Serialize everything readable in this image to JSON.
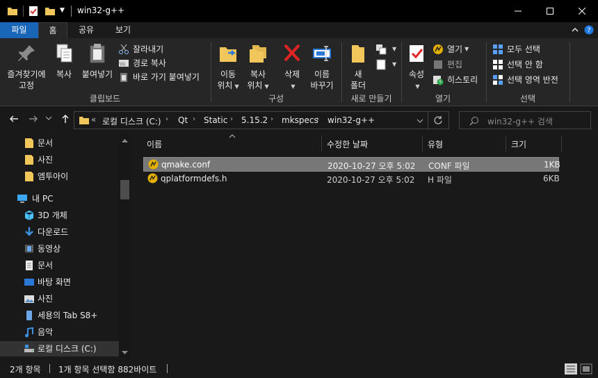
{
  "window": {
    "title": "win32-g++"
  },
  "ribbon_tabs": [
    "파일",
    "홈",
    "공유",
    "보기"
  ],
  "ribbon": {
    "clipboard": {
      "pin_label_1": "즐겨찾기에",
      "pin_label_2": "고정",
      "copy": "복사",
      "paste": "붙여넣기",
      "cut": "잘라내기",
      "copy_path": "경로 복사",
      "paste_shortcut": "바로 가기 붙여넣기",
      "group": "클립보드"
    },
    "organize": {
      "move_1": "이동",
      "move_2": "위치",
      "copy_1": "복사",
      "copy_2": "위치",
      "delete": "삭제",
      "rename_1": "이름",
      "rename_2": "바꾸기",
      "group": "구성"
    },
    "new": {
      "folder_1": "새",
      "folder_2": "폴더",
      "group": "새로 만들기"
    },
    "open": {
      "properties": "속성",
      "open": "열기",
      "edit": "편집",
      "history": "히스토리",
      "group": "열기"
    },
    "select": {
      "all": "모두 선택",
      "none": "선택 안 함",
      "invert": "선택 영역 반전",
      "group": "선택"
    }
  },
  "address": {
    "overflow": "«",
    "crumbs": [
      "로컬 디스크 (C:)",
      "Qt",
      "Static",
      "5.15.2",
      "mkspecs",
      "win32-g++"
    ],
    "search_placeholder": "win32-g++ 검색"
  },
  "sidebar": {
    "items": [
      {
        "label": "문서",
        "icon": "folder-icon"
      },
      {
        "label": "사진",
        "icon": "folder-icon"
      },
      {
        "label": "엠투아이",
        "icon": "folder-icon"
      },
      {
        "label": "내 PC",
        "icon": "pc-icon"
      },
      {
        "label": "3D 개체",
        "icon": "cube-icon"
      },
      {
        "label": "다운로드",
        "icon": "download-icon"
      },
      {
        "label": "동영상",
        "icon": "video-icon"
      },
      {
        "label": "문서",
        "icon": "document-icon"
      },
      {
        "label": "바탕 화면",
        "icon": "desktop-icon"
      },
      {
        "label": "사진",
        "icon": "picture-icon"
      },
      {
        "label": "세용의 Tab S8+",
        "icon": "tablet-icon"
      },
      {
        "label": "음악",
        "icon": "music-icon"
      },
      {
        "label": "로컬 디스크 (C:)",
        "icon": "drive-icon"
      }
    ]
  },
  "columns": [
    "이름",
    "수정한 날짜",
    "유형",
    "크기"
  ],
  "files": [
    {
      "name": "qmake.conf",
      "date": "2020-10-27 오후 5:02",
      "type": "CONF 파일",
      "size": "1KB",
      "selected": true
    },
    {
      "name": "qplatformdefs.h",
      "date": "2020-10-27 오후 5:02",
      "type": "H 파일",
      "size": "6KB",
      "selected": false
    }
  ],
  "status": {
    "count": "2개 항목",
    "selection": "1개 항목 선택함 882바이트"
  },
  "colors": {
    "file_tab": "#1966b8",
    "folder": "#f1c65b",
    "selected_row": "#777777"
  }
}
